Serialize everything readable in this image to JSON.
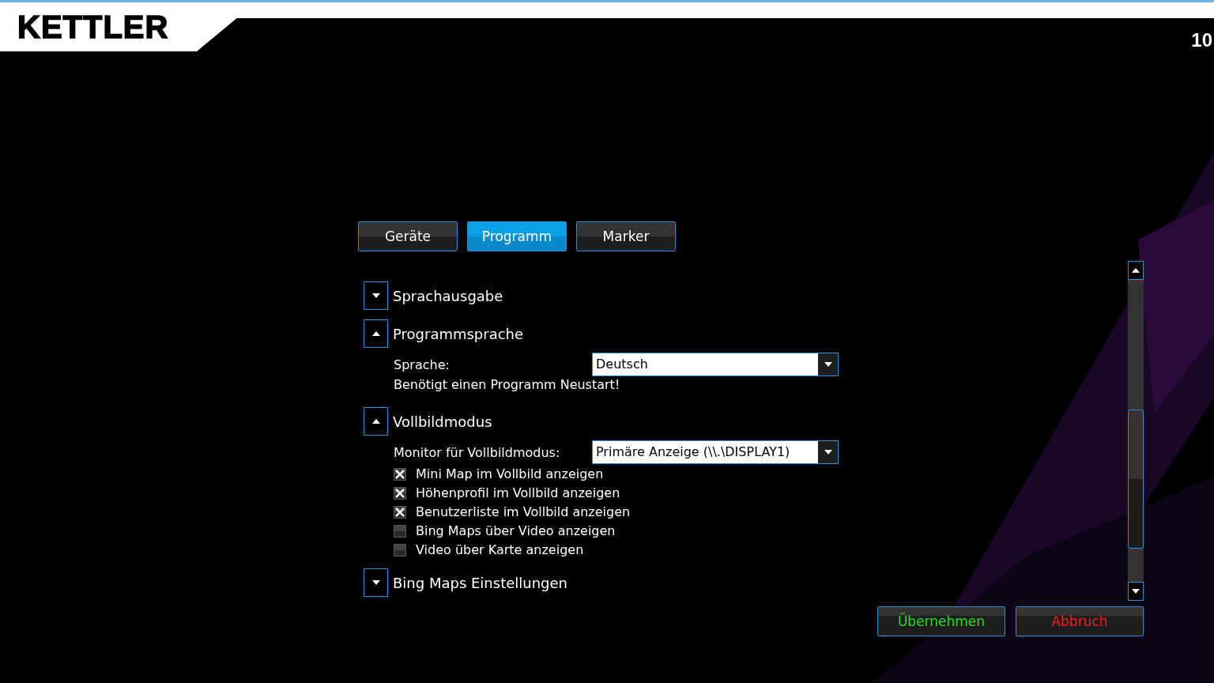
{
  "header": {
    "logo": "KETTLER",
    "corner_text": "10"
  },
  "tabs": [
    {
      "label": "Geräte",
      "selected": false
    },
    {
      "label": "Programm",
      "selected": true
    },
    {
      "label": "Marker",
      "selected": false
    }
  ],
  "sections": [
    {
      "title": "Sprachausgabe",
      "expanded": false
    },
    {
      "title": "Programmsprache",
      "expanded": true,
      "items": [
        {
          "kind": "select",
          "label": "Sprache:",
          "value": "Deutsch"
        },
        {
          "kind": "note",
          "text": "Benötigt einen Programm Neustart!"
        }
      ]
    },
    {
      "title": "Vollbildmodus",
      "expanded": true,
      "items": [
        {
          "kind": "select",
          "label": "Monitor für Vollbildmodus:",
          "value": "Primäre Anzeige (\\\\.\\DISPLAY1)"
        },
        {
          "kind": "checkbox",
          "label": "Mini Map im Vollbild anzeigen",
          "checked": true
        },
        {
          "kind": "checkbox",
          "label": "Höhenprofil im Vollbild anzeigen",
          "checked": true
        },
        {
          "kind": "checkbox",
          "label": "Benutzerliste im Vollbild anzeigen",
          "checked": true
        },
        {
          "kind": "checkbox",
          "label": "Bing Maps über Video anzeigen",
          "checked": false
        },
        {
          "kind": "checkbox",
          "label": "Video über Karte anzeigen",
          "checked": false
        }
      ]
    },
    {
      "title": "Bing Maps Einstellungen",
      "expanded": false
    }
  ],
  "buttons": [
    {
      "label": "Übernehmen",
      "kind": "apply"
    },
    {
      "label": "Abbruch",
      "kind": "cancel"
    }
  ]
}
